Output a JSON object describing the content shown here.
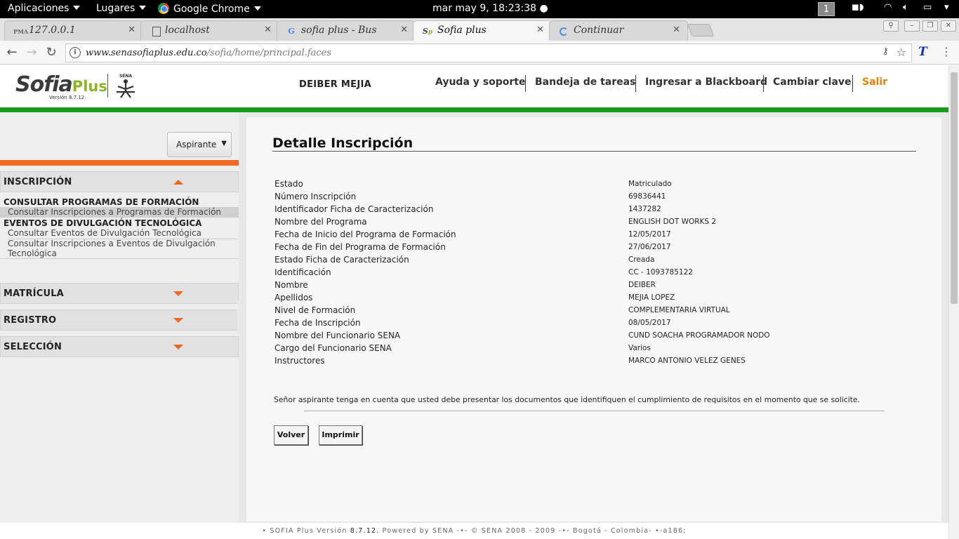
{
  "gnome": {
    "apps_label": "Aplicaciones",
    "places_label": "Lugares",
    "active_app": "Google Chrome",
    "clock": "mar may  9, 18:23:38",
    "workspace": "1"
  },
  "browser": {
    "tabs": [
      {
        "title": "127.0.0.1",
        "favicon": "pma-icon"
      },
      {
        "title": "localhost",
        "favicon": "page-icon"
      },
      {
        "title": "sofia plus - Bus",
        "favicon": "google-icon"
      },
      {
        "title": "Sofia plus",
        "favicon": "sofia-icon"
      },
      {
        "title": "Continuar",
        "favicon": "loading-icon"
      }
    ],
    "url_domain": "www.senasofiaplus.edu.co",
    "url_path": "/sofia/home/principal.faces"
  },
  "header": {
    "logo_text": "Sofia",
    "logo_plus": "Plus",
    "version": "Versión 8.7.12.",
    "user_name": "DEIBER MEJIA",
    "nav": [
      "Ayuda y soporte",
      "Bandeja de tareas",
      "Ingresar a Blackboard",
      "Cambiar clave",
      "Salir"
    ],
    "accent_color": "#f07d00",
    "green_color": "#159a1a"
  },
  "sidebar": {
    "role": "Aspirante",
    "sections": [
      {
        "title": "INSCRIPCIÓN",
        "expanded": true
      },
      {
        "title": "MATRÍCULA",
        "expanded": false
      },
      {
        "title": "REGISTRO",
        "expanded": false
      },
      {
        "title": "SELECCIÓN",
        "expanded": false
      }
    ],
    "inscripcion": {
      "group1": "CONSULTAR PROGRAMAS DE FORMACIÓN",
      "link1": "Consultar Inscripciones a Programas de Formación",
      "group2": "EVENTOS DE DIVULGACIÓN TECNOLÓGICA",
      "link2": "Consultar Eventos de Divulgación Tecnológica",
      "link3a": "Consultar Inscripciones a Eventos de Divulgación",
      "link3b": "Tecnológica"
    }
  },
  "detail": {
    "title": "Detalle Inscripción",
    "rows": [
      {
        "label": "Estado",
        "value": "Matriculado"
      },
      {
        "label": "Número Inscripción",
        "value": "69836441"
      },
      {
        "label": "Identificador Ficha de Caracterización",
        "value": "1437282"
      },
      {
        "label": "Nombre del Programa",
        "value": "ENGLISH DOT WORKS 2"
      },
      {
        "label": "Fecha de Inicio del Programa de Formación",
        "value": "12/05/2017"
      },
      {
        "label": "Fecha de Fin del Programa de Formación",
        "value": "27/06/2017"
      },
      {
        "label": "Estado Ficha de Caracterización",
        "value": "Creada"
      },
      {
        "label": "Identificación",
        "value": "CC - 1093785122"
      },
      {
        "label": "Nombre",
        "value": "DEIBER"
      },
      {
        "label": "Apellidos",
        "value": "MEJIA LOPEZ"
      },
      {
        "label": "Nivel de Formación",
        "value": "COMPLEMENTARIA VIRTUAL"
      },
      {
        "label": "Fecha de Inscripción",
        "value": "08/05/2017"
      },
      {
        "label": "Nombre del Funcionario SENA",
        "value": "CUND SOACHA PROGRAMADOR NODO"
      },
      {
        "label": "Cargo del Funcionario SENA",
        "value": "Varios"
      },
      {
        "label": "Instructores",
        "value": "MARCO ANTONIO VELEZ GENES"
      }
    ],
    "note": "Señor aspirante tenga en cuenta que usted debe presentar los documentos que identifiquen el cumplimiento de requisitos en el momento que se solicite.",
    "back_label": "Volver",
    "print_label": "Imprimir"
  },
  "footer": {
    "prefix": "• SOFIA Plus Versión ",
    "version": "8.7.12.",
    "suffix": " Powered by SENA -•- © SENA 2008 - 2009 -•- Bogotá - Colombia- •-a186;"
  }
}
